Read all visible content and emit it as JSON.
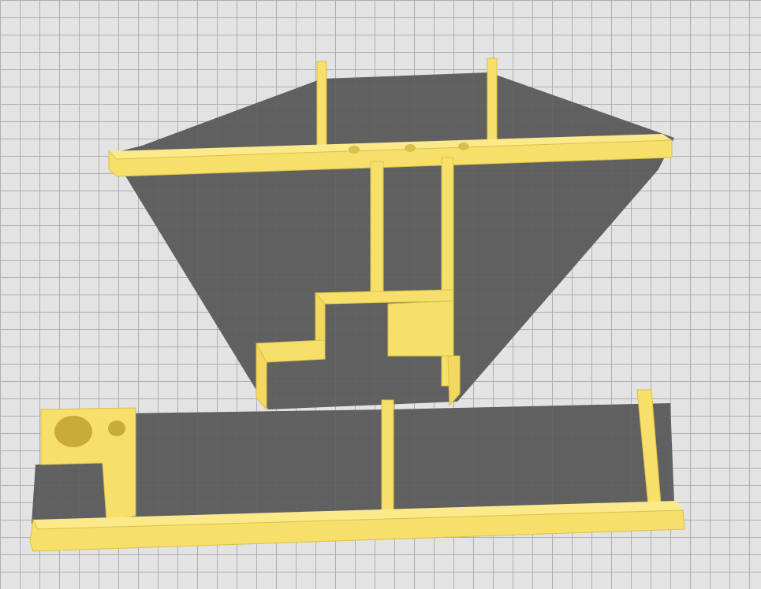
{
  "viewport": {
    "name": "3d-build-plate-view",
    "plate_color": "#e3e3e3",
    "grid_color": "#aaaaaa",
    "shadow_color": "#555555"
  },
  "objects": [
    {
      "name": "upper-frame-part",
      "color": "#f7e06a",
      "edge_color": "#d9c04a"
    },
    {
      "name": "lower-frame-part",
      "color": "#f7e06a",
      "edge_color": "#d9c04a"
    }
  ]
}
